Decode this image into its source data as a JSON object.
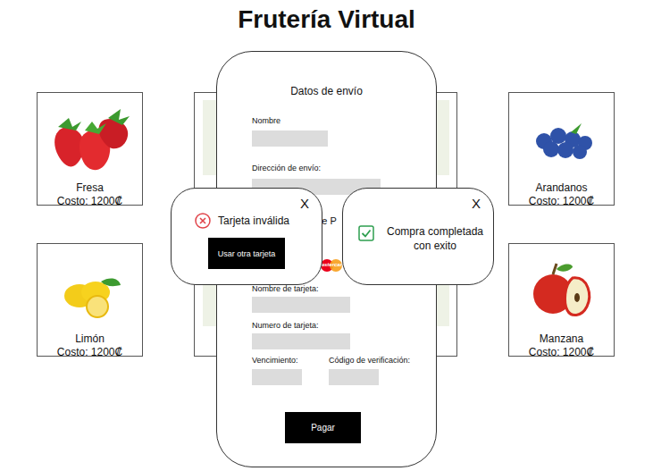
{
  "title": "Frutería Virtual",
  "products": [
    {
      "name": "Fresa",
      "price": "Costo: 1200₡",
      "kind": "strawberry"
    },
    {
      "name": "Arandanos",
      "price": "Costo: 1200₡",
      "kind": "blueberry"
    },
    {
      "name": "Limón",
      "price": "Costo: 1200₡",
      "kind": "lemon"
    },
    {
      "name": "Manzana",
      "price": "Costo: 1200₡",
      "kind": "apple"
    }
  ],
  "checkout": {
    "title": "Datos de envío",
    "shipping_fields": [
      {
        "label": "Nombre"
      },
      {
        "label": "Dirección de envío:"
      }
    ],
    "payment_heading": "de P",
    "card_brand": "mastercard",
    "card_fields": [
      {
        "label": "Nombre de tarjeta:"
      },
      {
        "label": "Numero de tarjeta:"
      }
    ],
    "bottom_fields": [
      {
        "label": "Vencimiento:"
      },
      {
        "label": "Código de verificación:"
      }
    ],
    "pay_button": "Pagar"
  },
  "error_popup": {
    "close": "X",
    "message": "Tarjeta inválida",
    "button": "Usar otra tarjeta"
  },
  "success_popup": {
    "close": "X",
    "message": "Compra completada con exito"
  }
}
